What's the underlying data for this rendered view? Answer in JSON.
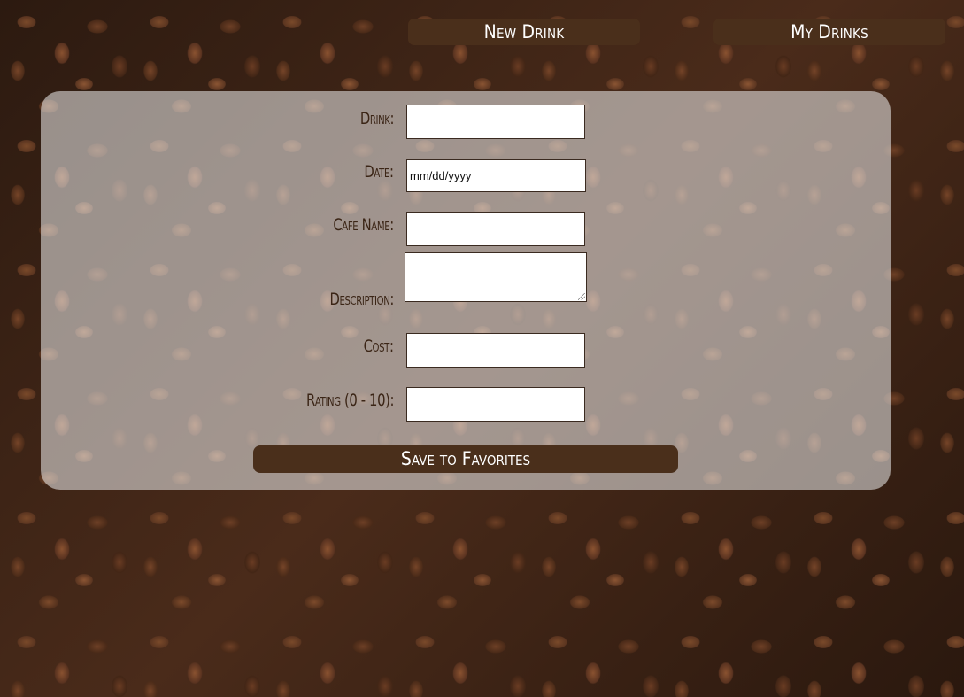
{
  "nav": {
    "new_drink": "New Drink",
    "my_drinks": "My Drinks"
  },
  "form": {
    "drink_label": "Drink:",
    "drink_value": "",
    "date_label": "Date:",
    "date_placeholder": "mm/dd/yyyy",
    "cafe_label": "Cafe Name:",
    "cafe_value": "",
    "description_label": "Description:",
    "description_value": "",
    "cost_label": "Cost:",
    "cost_value": "",
    "rating_label": "Rating (0 - 10):",
    "rating_value": "",
    "save_label": "Save to Favorites"
  },
  "colors": {
    "button_background": "#4a2f1b",
    "button_text": "#ffffff",
    "panel_overlay": "rgba(236,236,236,0.56)",
    "label_text": "#3b2516"
  },
  "background": {
    "image": "coffee-beans-background"
  }
}
